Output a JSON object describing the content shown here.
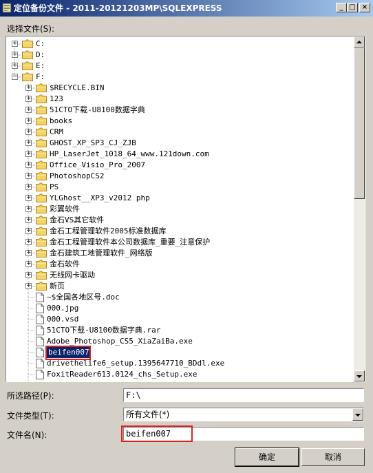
{
  "window": {
    "title": "定位备份文件 - 2011-20121203MP\\SQLEXPRESS"
  },
  "labels": {
    "select_file": "选择文件(S):",
    "selected_path": "所选路径(P):",
    "file_type": "文件类型(T):",
    "file_name": "文件名(N):"
  },
  "tree": {
    "items": [
      {
        "label": "C:",
        "kind": "folder",
        "level": 0,
        "expand": "+"
      },
      {
        "label": "D:",
        "kind": "folder",
        "level": 0,
        "expand": "+"
      },
      {
        "label": "E:",
        "kind": "folder",
        "level": 0,
        "expand": "+"
      },
      {
        "label": "F:",
        "kind": "folder",
        "level": 0,
        "expand": "-"
      },
      {
        "label": "$RECYCLE.BIN",
        "kind": "folder",
        "level": 1,
        "expand": "+"
      },
      {
        "label": "123",
        "kind": "folder",
        "level": 1,
        "expand": "+"
      },
      {
        "label": "51CTO下载-U8100数据字典",
        "kind": "folder",
        "level": 1,
        "expand": "+"
      },
      {
        "label": "books",
        "kind": "folder",
        "level": 1,
        "expand": "+"
      },
      {
        "label": "CRM",
        "kind": "folder",
        "level": 1,
        "expand": "+"
      },
      {
        "label": "GHOST_XP_SP3_CJ_ZJB",
        "kind": "folder",
        "level": 1,
        "expand": "+"
      },
      {
        "label": "HP_LaserJet_1018_64_www.121down.com",
        "kind": "folder",
        "level": 1,
        "expand": "+"
      },
      {
        "label": "Office_Visio_Pro_2007",
        "kind": "folder",
        "level": 1,
        "expand": "+"
      },
      {
        "label": "PhotoshopCS2",
        "kind": "folder",
        "level": 1,
        "expand": "+"
      },
      {
        "label": "PS",
        "kind": "folder",
        "level": 1,
        "expand": "+"
      },
      {
        "label": "YLGhost__XP3_v2012 php",
        "kind": "folder",
        "level": 1,
        "expand": "+"
      },
      {
        "label": "彩翼软件",
        "kind": "folder",
        "level": 1,
        "expand": "+"
      },
      {
        "label": "金石VS其它软件",
        "kind": "folder",
        "level": 1,
        "expand": "+"
      },
      {
        "label": "金石工程管理软件2005标准数据库",
        "kind": "folder",
        "level": 1,
        "expand": "+"
      },
      {
        "label": "金石工程管理软件本公司数据库_重要_注意保护",
        "kind": "folder",
        "level": 1,
        "expand": "+"
      },
      {
        "label": "金石建筑工地管理软件_网络版",
        "kind": "folder",
        "level": 1,
        "expand": "+"
      },
      {
        "label": "金石软件",
        "kind": "folder",
        "level": 1,
        "expand": "+"
      },
      {
        "label": "无线网卡驱动",
        "kind": "folder",
        "level": 1,
        "expand": "+"
      },
      {
        "label": "新页",
        "kind": "folder",
        "level": 1,
        "expand": "+"
      },
      {
        "label": "~$全国各地区号.doc",
        "kind": "file",
        "level": 1
      },
      {
        "label": "000.jpg",
        "kind": "file",
        "level": 1
      },
      {
        "label": "000.vsd",
        "kind": "file",
        "level": 1
      },
      {
        "label": "51CTO下载-U8100数据字典.rar",
        "kind": "file",
        "level": 1
      },
      {
        "label": "Adobe_Photoshop_CS5_XiaZaiBa.exe",
        "kind": "file",
        "level": 1
      },
      {
        "label": "beifen007",
        "kind": "file",
        "level": 1,
        "selected": true
      },
      {
        "label": "drivethelife6_setup.1395647710_BDdl.exe",
        "kind": "file",
        "level": 1
      },
      {
        "label": "FoxitReader613.0124_chs_Setup.exe",
        "kind": "file",
        "level": 1
      }
    ]
  },
  "selected_path_value": "F:\\",
  "file_type_value": "所有文件(*)",
  "file_name_value": "beifen007",
  "buttons": {
    "ok": "确定",
    "cancel": "取消"
  },
  "colors": {
    "title_start": "#0a246a",
    "title_end": "#a6caf0",
    "selection": "#0a246a",
    "highlight_box": "#e02020",
    "folder": "#f4d36a"
  }
}
